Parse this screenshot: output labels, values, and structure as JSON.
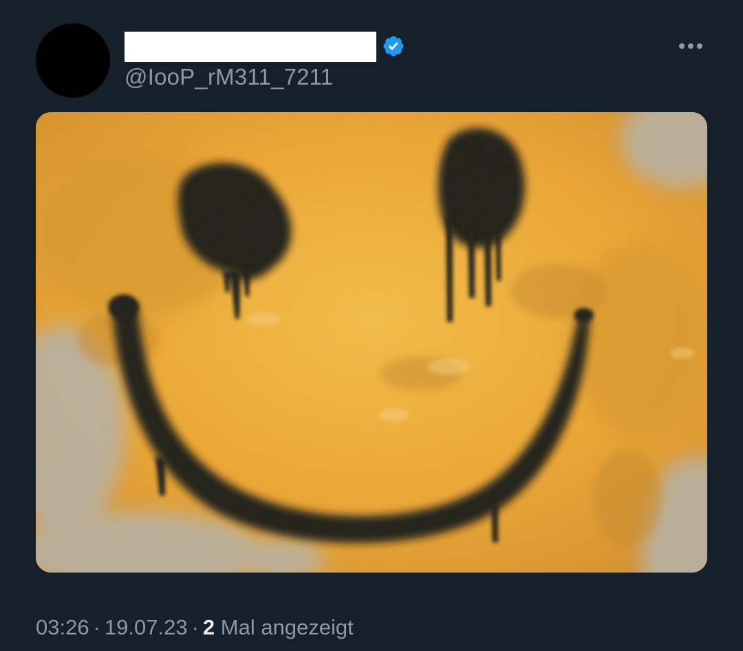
{
  "tweet": {
    "author": {
      "display_name": "",
      "handle": "@IooP_rM311_7211",
      "verified": true,
      "verified_color": "#1d9bf0",
      "avatar_color": "#000000",
      "name_redaction_color": "#ffffff"
    },
    "more_icon": "more-horizontal-icon",
    "media": {
      "description_icon": "image",
      "palette": {
        "paint": "#f2a72a",
        "paint_light": "#f7bf45",
        "wall": "#b9b3a6",
        "spray": "#141210"
      }
    },
    "meta": {
      "time": "03:26",
      "separator": "·",
      "date": "19.07.23",
      "views_count": "2",
      "views_label": "Mal angezeigt"
    }
  },
  "theme": {
    "background": "#15202b",
    "primary_text": "#e7e9ea",
    "secondary_text": "#8b98a5"
  }
}
